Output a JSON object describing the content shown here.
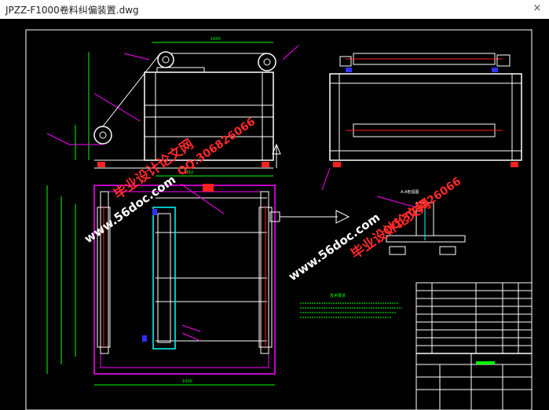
{
  "window": {
    "title": "JPZZ-F1000卷料纠偏装置.dwg",
    "close_glyph": "×"
  },
  "drawing": {
    "watermark_text": "毕业设计论文网",
    "watermark_url": "www.56doc.com",
    "watermark_qq": "QQ:306826066",
    "section_label": "A-A剖视图",
    "tech_req_title": "技术要求",
    "dim_top_width": "1000",
    "dim_bottom_width": "1000",
    "colors": {
      "frame": "#ffffff",
      "green": "#00ff00",
      "magenta": "#ff00ff",
      "red": "#ff2020",
      "cyan": "#00ffff",
      "yellow": "#ffff00",
      "blue": "#3030ff",
      "watermark_red": "#ff2a2a",
      "watermark_white": "#ffffff"
    }
  }
}
